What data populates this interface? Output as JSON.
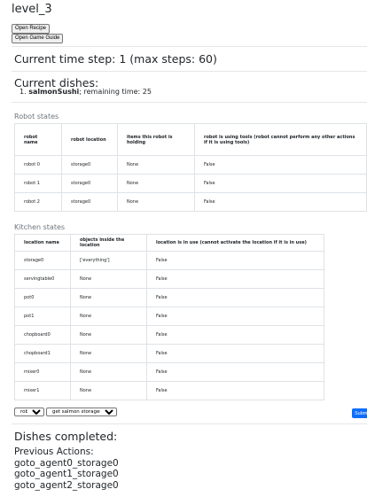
{
  "title": "level_3",
  "buttons": {
    "open_recipe": "Open Recipe",
    "open_game_guide": "Open Game Guide"
  },
  "time_step": "Current time step: 1 (max steps: 60)",
  "current_dishes": {
    "heading": "Current dishes:",
    "items": [
      {
        "number": "1.",
        "name": "salmonSushi",
        "suffix": "; remaining time: 25"
      }
    ]
  },
  "robot_states": {
    "title": "Robot states",
    "headers": [
      "robot name",
      "robot location",
      "items this robot is holding",
      "robot is using tools (robot cannot perform any other actions if it is using tools)"
    ],
    "rows": [
      [
        "robot 0",
        "storage0",
        "None",
        "False"
      ],
      [
        "robot 1",
        "storage0",
        "None",
        "False"
      ],
      [
        "robot 2",
        "storage0",
        "None",
        "False"
      ]
    ]
  },
  "kitchen_states": {
    "title": "Kitchen states",
    "headers": [
      "location name",
      "objects inside the location",
      "location is in use (cannot activate the location if it is in use)"
    ],
    "rows": [
      [
        "storage0",
        "['everything']",
        "False"
      ],
      [
        "servingtable0",
        "None",
        "False"
      ],
      [
        "pot0",
        "None",
        "False"
      ],
      [
        "pot1",
        "None",
        "False"
      ],
      [
        "chopboard0",
        "None",
        "False"
      ],
      [
        "chopboard1",
        "None",
        "False"
      ],
      [
        "mixer0",
        "None",
        "False"
      ],
      [
        "mixer1",
        "None",
        "False"
      ]
    ]
  },
  "controls": {
    "robot_select": "robot 0",
    "action_select": "get salmon storage0",
    "submit_label": "Submit"
  },
  "dishes_completed": "Dishes completed:",
  "previous_actions": {
    "heading": "Previous Actions:",
    "items": [
      "goto_agent0_storage0",
      "goto_agent1_storage0",
      "goto_agent2_storage0"
    ]
  }
}
